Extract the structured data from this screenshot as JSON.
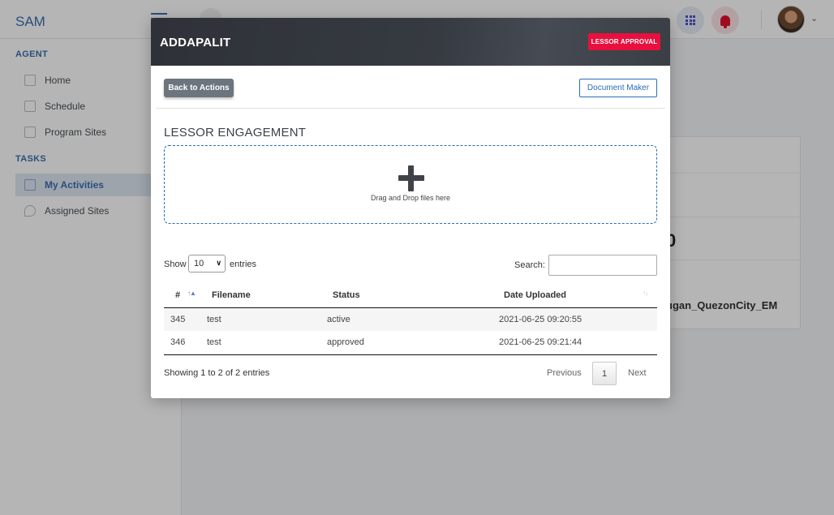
{
  "app": {
    "brand": "SAM",
    "sidebar": {
      "sections": [
        {
          "label": "AGENT",
          "items": [
            {
              "label": "Home"
            },
            {
              "label": "Schedule"
            },
            {
              "label": "Program Sites"
            }
          ]
        },
        {
          "label": "TASKS",
          "items": [
            {
              "label": "My Activities",
              "active": true
            },
            {
              "label": "Assigned Sites"
            }
          ]
        }
      ]
    },
    "background_card": {
      "partial_value": "0",
      "site_name": "ugan_QuezonCity_EM"
    }
  },
  "modal": {
    "title": "ADDAPALIT",
    "status_badge": "LESSOR APPROVAL",
    "back_button": "Back to Actions",
    "document_maker_button": "Document Maker",
    "section_title": "LESSOR ENGAGEMENT",
    "dropzone": {
      "icon": "plus-icon",
      "text": "Drag and Drop files here"
    },
    "table_controls": {
      "show_label": "Show",
      "entries_value": "10",
      "entries_label": "entries",
      "search_label": "Search:",
      "search_value": ""
    },
    "table": {
      "columns": [
        "#",
        "Filename",
        "Status",
        "Date Uploaded"
      ],
      "rows": [
        {
          "id": "345",
          "filename": "test",
          "status": "active",
          "date": "2021-06-25 09:20:55"
        },
        {
          "id": "346",
          "filename": "test",
          "status": "approved",
          "date": "2021-06-25 09:21:44"
        }
      ]
    },
    "footer": {
      "info": "Showing 1 to 2 of 2 entries",
      "previous": "Previous",
      "page": "1",
      "next": "Next"
    }
  },
  "colors": {
    "badge": "#e8103e",
    "primary": "#2a6db7",
    "header": "#363a41"
  }
}
